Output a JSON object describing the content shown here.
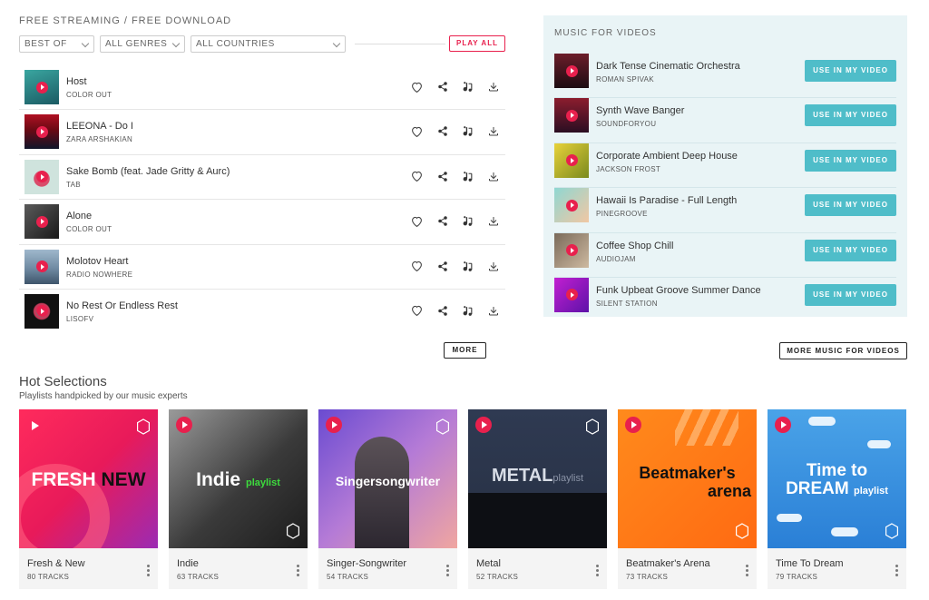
{
  "header": {
    "title": "FREE STREAMING / FREE DOWNLOAD"
  },
  "filters": {
    "sort": "BEST OF",
    "genre": "ALL GENRES",
    "country": "ALL COUNTRIES",
    "play_all": "PLAY ALL"
  },
  "tracks": [
    {
      "title": "Host",
      "artist": "COLOR OUT"
    },
    {
      "title": "LEEONA - Do I",
      "artist": "ZARA ARSHAKIAN"
    },
    {
      "title": "Sake Bomb (feat. Jade Gritty & Aurc)",
      "artist": "TAB"
    },
    {
      "title": "Alone",
      "artist": "COLOR OUT"
    },
    {
      "title": "Molotov Heart",
      "artist": "RADIO NOWHERE"
    },
    {
      "title": "No Rest Or Endless Rest",
      "artist": "LISOFV"
    }
  ],
  "more_label": "MORE",
  "videos": {
    "title": "MUSIC FOR VIDEOS",
    "use_label": "USE IN MY VIDEO",
    "more_label": "MORE MUSIC FOR VIDEOS",
    "items": [
      {
        "title": "Dark Tense Cinematic Orchestra",
        "artist": "ROMAN SPIVAK"
      },
      {
        "title": "Synth Wave Banger",
        "artist": "SOUNDFORYOU"
      },
      {
        "title": "Corporate Ambient Deep House",
        "artist": "JACKSON FROST"
      },
      {
        "title": "Hawaii Is Paradise - Full Length",
        "artist": "PINEGROOVE"
      },
      {
        "title": "Coffee Shop Chill",
        "artist": "AUDIOJAM"
      },
      {
        "title": "Funk Upbeat Groove Summer Dance",
        "artist": "SILENT STATION"
      }
    ]
  },
  "hot": {
    "title": "Hot Selections",
    "subtitle": "Playlists handpicked by our music experts",
    "playlists": [
      {
        "name": "Fresh & New",
        "tracks": "80 TRACKS",
        "cover_a": "FRESH",
        "cover_b": "NEW"
      },
      {
        "name": "Indie",
        "tracks": "63 TRACKS",
        "cover_a": "Indie",
        "cover_b": "playlist"
      },
      {
        "name": "Singer-Songwriter",
        "tracks": "54 TRACKS",
        "cover_a": "Singersongwriter",
        "cover_b": ""
      },
      {
        "name": "Metal",
        "tracks": "52 TRACKS",
        "cover_a": "METAL",
        "cover_b": "playlist"
      },
      {
        "name": "Beatmaker's Arena",
        "tracks": "73 TRACKS",
        "cover_a": "Beatmaker's",
        "cover_b": "arena"
      },
      {
        "name": "Time To Dream",
        "tracks": "79 TRACKS",
        "cover_a": "Time to",
        "cover_b": "DREAM",
        "cover_c": "playlist"
      }
    ]
  },
  "colors": {
    "accent": "#e8204d",
    "teal": "#4fbdc9",
    "panel": "#e9f4f6"
  },
  "icons": [
    "heart-icon",
    "share-icon",
    "playlist-add-icon",
    "download-icon",
    "chevron-down-icon",
    "play-icon",
    "more-vertical-icon",
    "logo-hex-icon"
  ]
}
